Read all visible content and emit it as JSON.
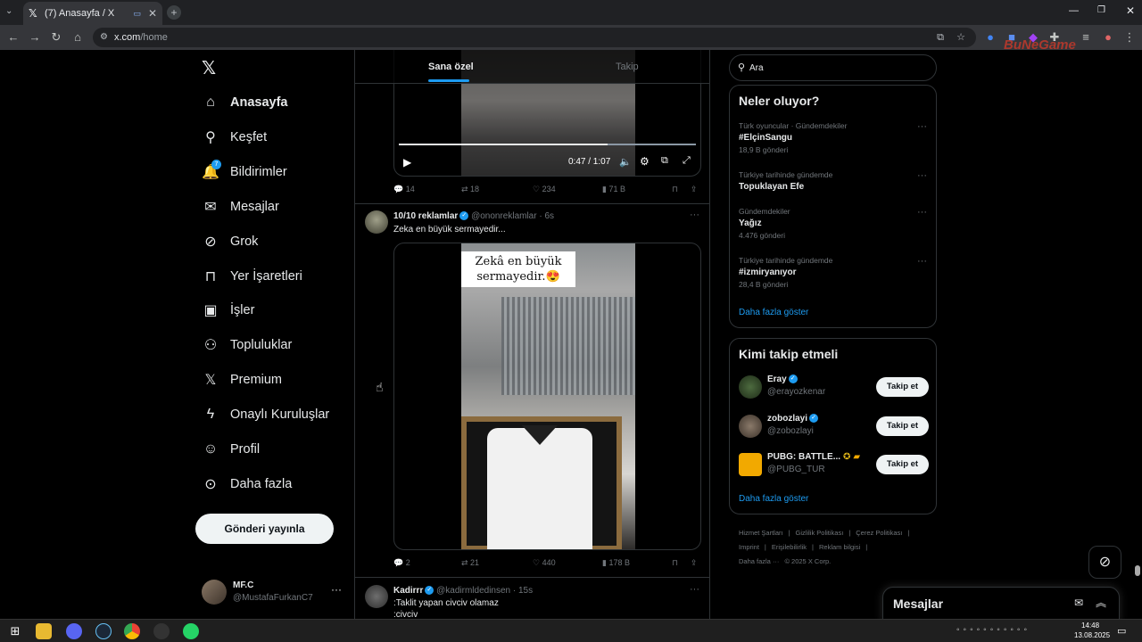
{
  "browser": {
    "tab_title": "(7) Anasayfa / X",
    "url_host": "x.com",
    "url_path": "/home",
    "watermark": "BuNeGame"
  },
  "nav": {
    "items": [
      {
        "label": "Anasayfa",
        "icon": "home-icon"
      },
      {
        "label": "Keşfet",
        "icon": "search-icon"
      },
      {
        "label": "Bildirimler",
        "icon": "bell-icon",
        "badge": "7"
      },
      {
        "label": "Mesajlar",
        "icon": "mail-icon"
      },
      {
        "label": "Grok",
        "icon": "grok-icon"
      },
      {
        "label": "Yer İşaretleri",
        "icon": "bookmark-icon"
      },
      {
        "label": "İşler",
        "icon": "briefcase-icon"
      },
      {
        "label": "Topluluklar",
        "icon": "people-icon"
      },
      {
        "label": "Premium",
        "icon": "x-icon"
      },
      {
        "label": "Onaylı Kuruluşlar",
        "icon": "lightning-icon"
      },
      {
        "label": "Profil",
        "icon": "user-icon"
      },
      {
        "label": "Daha fazla",
        "icon": "more-circle-icon"
      }
    ],
    "post_button": "Gönderi yayınla",
    "account": {
      "name": "MF.C",
      "handle": "@MustafaFurkanC7"
    }
  },
  "feed": {
    "tabs": [
      "Sana özel",
      "Takip"
    ],
    "video_time": "0:47 / 1:07",
    "tweet0_stats": {
      "replies": "14",
      "reposts": "18",
      "likes": "234",
      "views": "71 B"
    },
    "tweets": [
      {
        "name": "10/10 reklamlar",
        "handle": "@ononreklamlar",
        "time": "· 6s",
        "text": "Zeka en büyük sermayedir...",
        "media_caption": "Zekâ en büyük sermayedir.😍",
        "stats": {
          "replies": "2",
          "reposts": "21",
          "likes": "440",
          "views": "178 B"
        }
      },
      {
        "name": "Kadirrr",
        "handle": "@kadirmldedinsen",
        "time": "· 15s",
        "text_line1": ":Taklit yapan civciv olamaz",
        "text_line2": ":civciv"
      }
    ]
  },
  "search": {
    "placeholder": "Ara"
  },
  "trends": {
    "title": "Neler oluyor?",
    "items": [
      {
        "context": "Türk oyuncular · Gündemdekiler",
        "name": "#ElçinSangu",
        "count": "18,9 B gönderi"
      },
      {
        "context": "Türkiye tarihinde gündemde",
        "name": "Topuklayan Efe",
        "count": ""
      },
      {
        "context": "Gündemdekiler",
        "name": "Yağız",
        "count": "4.476 gönderi"
      },
      {
        "context": "Türkiye tarihinde gündemde",
        "name": "#izmiryanıyor",
        "count": "28,4 B gönderi"
      }
    ],
    "show_more": "Daha fazla göster"
  },
  "who_to_follow": {
    "title": "Kimi takip etmeli",
    "items": [
      {
        "name": "Eray",
        "handle": "@erayozkenar",
        "button": "Takip et"
      },
      {
        "name": "zobozlayi",
        "handle": "@zobozlayi",
        "button": "Takip et"
      },
      {
        "name": "PUBG: BATTLE...",
        "handle": "@PUBG_TUR",
        "button": "Takip et"
      }
    ],
    "show_more": "Daha fazla göster"
  },
  "footer": {
    "line1": [
      "Hizmet Şartları",
      "|",
      "Gizlilik Politikası",
      "|",
      "Çerez Politikası",
      "|"
    ],
    "line2": [
      "Imprint",
      "|",
      "Erişilebilirlik",
      "|",
      "Reklam bilgisi",
      "|"
    ],
    "line3": [
      "Daha fazla ···",
      "© 2025 X Corp."
    ]
  },
  "messages_drawer": {
    "title": "Mesajlar"
  },
  "taskbar": {
    "time": "14:48",
    "date": "13.08.2025"
  },
  "colors": {
    "accent": "#1d9bf0",
    "background": "#000000",
    "border": "#2f3336",
    "muted": "#71767b"
  }
}
